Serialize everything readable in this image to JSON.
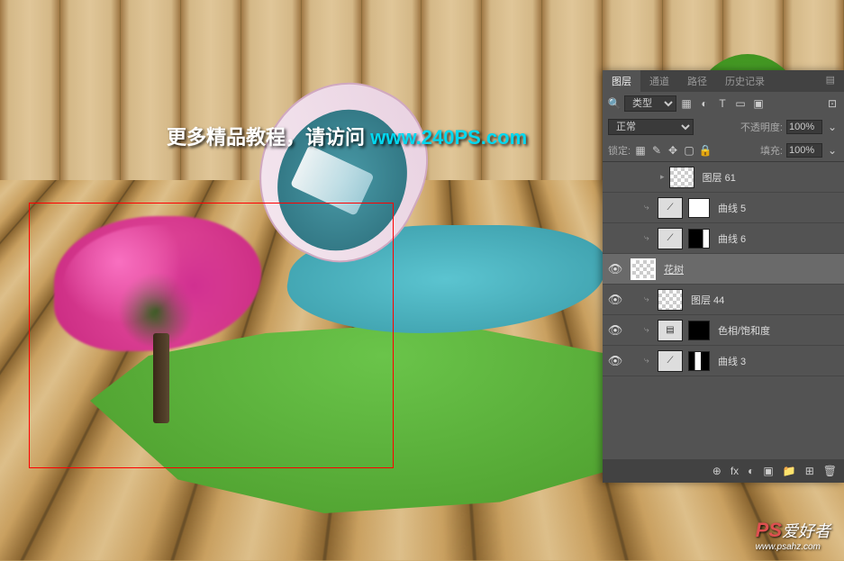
{
  "watermark": {
    "text": "更多精品教程，请访问 ",
    "url": "www.240PS.com"
  },
  "logo": {
    "ps": "PS",
    "text": "爱好者",
    "domain": "www.psahz.com"
  },
  "panel": {
    "tabs": {
      "layers": "图层",
      "channels": "通道",
      "paths": "路径",
      "history": "历史记录"
    },
    "filter": {
      "kind_label": "类型",
      "search_icon": "🔍"
    },
    "blend": {
      "mode": "正常",
      "opacity_label": "不透明度:",
      "opacity_value": "100%"
    },
    "lock": {
      "label": "锁定:",
      "fill_label": "填充:",
      "fill_value": "100%"
    },
    "layers": [
      {
        "name": "图层 61",
        "type": "raster",
        "indent": 2,
        "visible": false
      },
      {
        "name": "曲线 5",
        "type": "adjustment",
        "indent": 1,
        "visible": false,
        "mask": "white",
        "clip": true
      },
      {
        "name": "曲线 6",
        "type": "adjustment",
        "indent": 1,
        "visible": false,
        "mask": "partial",
        "clip": true
      },
      {
        "name": "花树",
        "type": "raster",
        "indent": 0,
        "visible": true,
        "selected": true,
        "underline": true
      },
      {
        "name": "图层 44",
        "type": "raster",
        "indent": 1,
        "visible": true,
        "clip": true
      },
      {
        "name": "色相/饱和度",
        "type": "adjustment",
        "indent": 1,
        "visible": true,
        "mask": "dark",
        "clip": true
      },
      {
        "name": "曲线 3",
        "type": "adjustment",
        "indent": 1,
        "visible": true,
        "mask": "partial2",
        "clip": true
      }
    ],
    "footer_icons": [
      "⊕",
      "fx",
      "◐",
      "▣",
      "📁",
      "⊞",
      "🗑"
    ]
  }
}
